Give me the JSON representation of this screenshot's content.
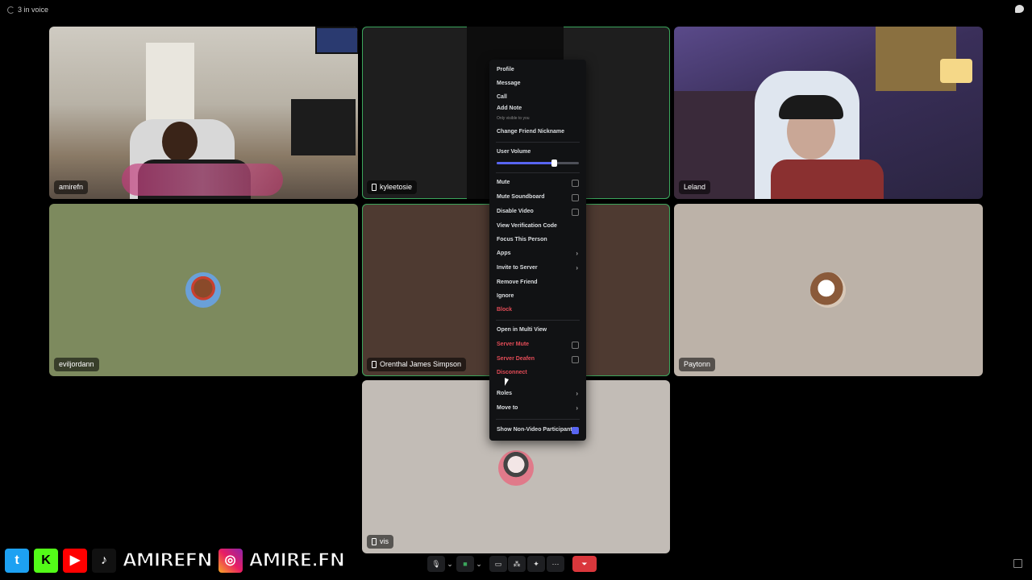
{
  "window": {
    "title": "3 in voice"
  },
  "participants": [
    {
      "name": "amirefn",
      "mobile": false
    },
    {
      "name": "kyleetosie",
      "mobile": true
    },
    {
      "name": "Leland",
      "mobile": false
    },
    {
      "name": "eviljordann",
      "mobile": false
    },
    {
      "name": "Orenthal James Simpson",
      "mobile": true
    },
    {
      "name": "Paytonn",
      "mobile": false
    },
    {
      "name": "vis",
      "mobile": true
    }
  ],
  "context_menu": {
    "profile": "Profile",
    "message": "Message",
    "call": "Call",
    "add_note": "Add Note",
    "add_note_sub": "Only visible to you",
    "change_nickname": "Change Friend Nickname",
    "user_volume": "User Volume",
    "volume_level": 0.7,
    "mute": "Mute",
    "mute_soundboard": "Mute Soundboard",
    "disable_video": "Disable Video",
    "view_verification": "View Verification Code",
    "focus_person": "Focus This Person",
    "apps": "Apps",
    "invite_server": "Invite to Server",
    "remove_friend": "Remove Friend",
    "ignore": "Ignore",
    "block": "Block",
    "open_multi_view": "Open in Multi View",
    "server_mute": "Server Mute",
    "server_deafen": "Server Deafen",
    "disconnect": "Disconnect",
    "roles": "Roles",
    "move_to": "Move to",
    "show_non_video": "Show Non-Video Participants",
    "show_non_video_checked": true
  },
  "overlay": {
    "handle1": "AMIREFN",
    "handle2": "AMIRE.FN"
  },
  "colors": {
    "accent": "#5865f2",
    "danger": "#e34c57",
    "active_border": "#3ba55c",
    "tile_green": "#7d8a5e",
    "tile_brown": "#4e3a31",
    "tile_beige": "#bcb2a8"
  }
}
